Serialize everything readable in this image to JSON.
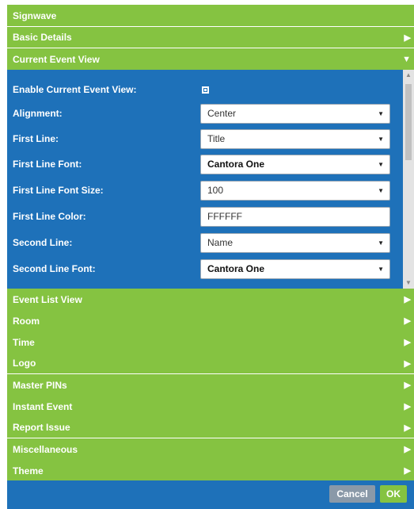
{
  "dialog": {
    "title": "Signwave"
  },
  "sections_top": [
    {
      "label": "Basic Details",
      "arrow": "▶"
    }
  ],
  "current_section": {
    "label": "Current Event View",
    "arrow": "▼"
  },
  "form": {
    "enable_label": "Enable Current Event View:",
    "enable_checked": true,
    "alignment": {
      "label": "Alignment:",
      "value": "Center"
    },
    "first_line": {
      "label": "First Line:",
      "value": "Title"
    },
    "first_line_font": {
      "label": "First Line Font:",
      "value": "Cantora One"
    },
    "first_line_font_size": {
      "label": "First Line Font Size:",
      "value": "100"
    },
    "first_line_color": {
      "label": "First Line Color:",
      "value": "FFFFFF"
    },
    "second_line": {
      "label": "Second Line:",
      "value": "Name"
    },
    "second_line_font": {
      "label": "Second Line Font:",
      "value": "Cantora One"
    }
  },
  "sections_bottom": [
    {
      "label": "Event List View",
      "arrow": "▶"
    },
    {
      "label": "Room",
      "arrow": "▶"
    },
    {
      "label": "Time",
      "arrow": "▶"
    },
    {
      "label": "Logo",
      "arrow": "▶"
    },
    {
      "label": "Master PINs",
      "arrow": "▶"
    },
    {
      "label": "Instant Event",
      "arrow": "▶"
    },
    {
      "label": "Report Issue",
      "arrow": "▶"
    },
    {
      "label": "Miscellaneous",
      "arrow": "▶"
    },
    {
      "label": "Theme",
      "arrow": "▶"
    }
  ],
  "footer": {
    "cancel_label": "Cancel",
    "ok_label": "OK"
  },
  "colors": {
    "green": "#85c341",
    "blue": "#1e71b9",
    "gray_button": "#8a99a8"
  },
  "icons": {
    "expand": "triangle-right-icon",
    "collapse": "triangle-down-icon",
    "dropdown": "caret-down-icon"
  }
}
